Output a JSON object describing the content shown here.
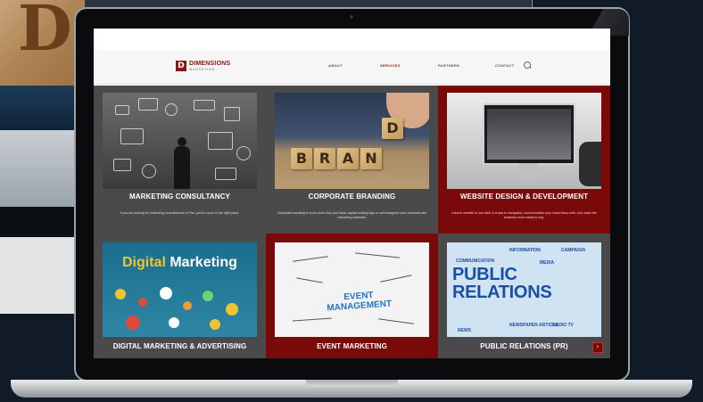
{
  "site": {
    "logo_mark": "D",
    "logo_word": "DIMENSIONS",
    "logo_sub": "MARKETING"
  },
  "nav": {
    "items": [
      {
        "label": "ABOUT",
        "active": false
      },
      {
        "label": "SERVICES",
        "active": true
      },
      {
        "label": "PARTNERS",
        "active": false
      },
      {
        "label": "CONTACT",
        "active": false
      }
    ]
  },
  "services": [
    {
      "title": "MARKETING CONSULTANCY",
      "description": "If you are looking for marketing consultancies in Pan, you've come to the right place."
    },
    {
      "title": "CORPORATE BRANDING",
      "description": "Corporate branding is much more than just these capital looking logo or well designed color schemes and marketing materials."
    },
    {
      "title": "WEBSITE DESIGN & DEVELOPMENT",
      "description": "Launch website is one click in a way to navigation, commercialize your brand story with, and make the business more easily to buy."
    },
    {
      "title": "DIGITAL MARKETING & ADVERTISING",
      "description": ""
    },
    {
      "title": "EVENT MARKETING",
      "description": ""
    },
    {
      "title": "PUBLIC RELATIONS (PR)",
      "description": ""
    }
  ],
  "images": {
    "branding_blocks": [
      "B",
      "R",
      "A",
      "N",
      "D"
    ],
    "digital_title_a": "Digital",
    "digital_title_b": " Marketing",
    "event_word_1": "EVENT",
    "event_word_2": "MANAGEMENT",
    "pr_word_1": "PUBLIC",
    "pr_word_2": "RELATIONS",
    "pr_labels": [
      "INFORMATION",
      "CAMPAIGN",
      "COMMUNICATION",
      "MEDIA",
      "NEWSPAPER ARTICLE",
      "RADIO TV",
      "NEWS"
    ]
  },
  "scroll_arrow": "›",
  "colors": {
    "brand_red": "#7a0a0a",
    "tile_gray": "#4a4a4c",
    "background": "#111a27"
  }
}
